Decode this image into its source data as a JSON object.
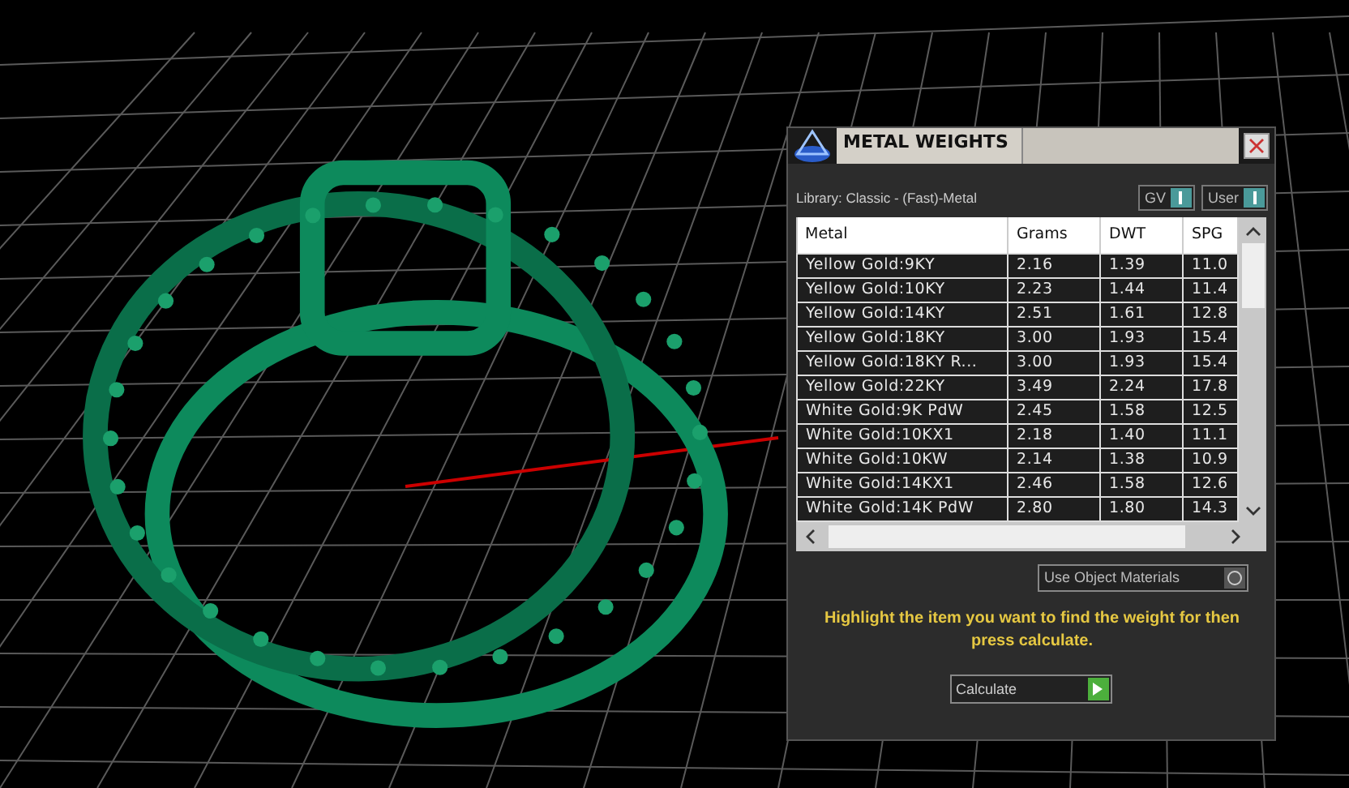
{
  "panel": {
    "title": "METAL WEIGHTS",
    "library": "Library: Classic - (Fast)-Metal",
    "toggles": [
      {
        "label": "GV"
      },
      {
        "label": "User"
      }
    ],
    "table": {
      "columns": [
        "Metal",
        "Grams",
        "DWT",
        "SPG"
      ],
      "rows": [
        [
          "Yellow Gold:9KY",
          "2.16",
          "1.39",
          "11.0"
        ],
        [
          "Yellow Gold:10KY",
          "2.23",
          "1.44",
          "11.4"
        ],
        [
          "Yellow Gold:14KY",
          "2.51",
          "1.61",
          "12.8"
        ],
        [
          "Yellow Gold:18KY",
          "3.00",
          "1.93",
          "15.4"
        ],
        [
          "Yellow Gold:18KY R...",
          "3.00",
          "1.93",
          "15.4"
        ],
        [
          "Yellow Gold:22KY",
          "3.49",
          "2.24",
          "17.8"
        ],
        [
          "White Gold:9K PdW",
          "2.45",
          "1.58",
          "12.5"
        ],
        [
          "White Gold:10KX1",
          "2.18",
          "1.40",
          "11.1"
        ],
        [
          "White Gold:10KW",
          "2.14",
          "1.38",
          "10.9"
        ],
        [
          "White Gold:14KX1",
          "2.46",
          "1.58",
          "12.6"
        ],
        [
          "White Gold:14K PdW",
          "2.80",
          "1.80",
          "14.3"
        ]
      ]
    },
    "material_option": "Use Object Materials",
    "hint": "Highlight the item you want to find the weight for then press calculate.",
    "calculate_button": "Calculate"
  }
}
